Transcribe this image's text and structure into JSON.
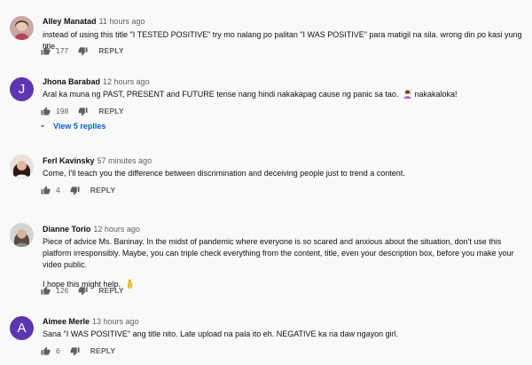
{
  "comments": [
    {
      "author": "Alley Manatad",
      "time": "11 hours ago",
      "text": "instead of using this title \"I TESTED POSITIVE\" try mo nalang po palitan \"I WAS POSITIVE\" para matigil na sila. wrong din po kasi yung title.",
      "likes": "177",
      "reply_label": "REPLY"
    },
    {
      "author": "Jhona Barabad",
      "time": "12 hours ago",
      "avatar_letter": "J",
      "avatar_color": "#5e35b1",
      "text": "Aral ka muna  ng PAST, PRESENT and FUTURE tense nang hindi nakakapag cause ng panic sa tao.",
      "text_after_emoji": "nakakaloka!",
      "emoji": "woman-raising-hand-emoji",
      "likes": "198",
      "reply_label": "REPLY",
      "view_replies": "View 5 replies"
    },
    {
      "author": "Ferl Kavinsky",
      "time": "57 minutes ago",
      "text": "Come, I'll teach you the difference between discrimination and deceiving people just to trend a content.",
      "likes": "4",
      "reply_label": "REPLY"
    },
    {
      "author": "Dianne Torio",
      "time": "12 hours ago",
      "text": "Piece of advice Ms. Baninay. In the midst of pandemic where everyone is so scared and anxious about the situation, don't use this platform irresponsibly. Maybe, you can triple check everything from the content, title, even your description box, before you make your video public.",
      "text2": "I hope this might help.",
      "emoji": "crossed-fingers-emoji",
      "likes": "126",
      "reply_label": "REPLY"
    },
    {
      "author": "Aimee Merle",
      "time": "13 hours ago",
      "avatar_letter": "A",
      "avatar_color": "#5e35b1",
      "text": "Sana \"I WAS POSITIVE\" ang title nito. Late upload na pala ito eh. NEGATIVE ka na daw ngayon girl.",
      "likes": "6",
      "reply_label": "REPLY"
    }
  ],
  "colors": {
    "background": "#f9f9f9",
    "link_blue": "#065fd4",
    "muted_text": "#606060"
  }
}
